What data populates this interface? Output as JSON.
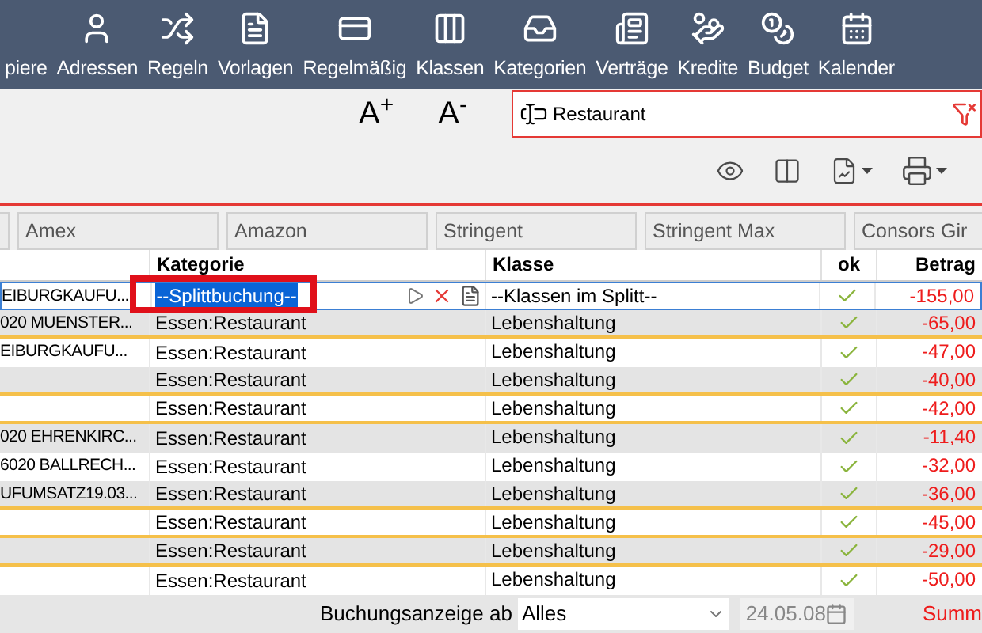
{
  "toolbar": [
    {
      "label": "piere"
    },
    {
      "label": "Adressen"
    },
    {
      "label": "Regeln"
    },
    {
      "label": "Vorlagen"
    },
    {
      "label": "Regelmäßig"
    },
    {
      "label": "Klassen"
    },
    {
      "label": "Kategorien"
    },
    {
      "label": "Verträge"
    },
    {
      "label": "Kredite"
    },
    {
      "label": "Budget"
    },
    {
      "label": "Kalender"
    }
  ],
  "font_buttons": [
    "A$^{+}$",
    "A$^{-}$"
  ],
  "search": {
    "value": "Restaurant"
  },
  "account_tabs": [
    "Amex",
    "Amazon",
    "Stringent",
    "Stringent Max",
    "Consors Gir"
  ],
  "table": {
    "columns": [
      "Kategorie",
      "Klasse",
      "ok",
      "Betrag"
    ],
    "rows": [
      {
        "column_1": "EIBURGKAUFU...",
        "kategorie": "--Splittbuchung--",
        "klasse": "--Klassen im Splitt--",
        "ok": true,
        "betrag": "-155,00",
        "selected": true,
        "separator_below": false
      },
      {
        "column_1": "020 MUENSTER...",
        "kategorie": "Essen:Restaurant",
        "klasse": "Lebenshaltung",
        "ok": true,
        "betrag": "-65,00",
        "selected": false,
        "separator_below": true
      },
      {
        "column_1": "EIBURGKAUFU...",
        "kategorie": "Essen:Restaurant",
        "klasse": "Lebenshaltung",
        "ok": true,
        "betrag": "-47,00",
        "selected": false,
        "separator_below": false
      },
      {
        "kategorie": "Essen:Restaurant",
        "klasse": "Lebenshaltung",
        "ok": true,
        "betrag": "-40,00",
        "selected": false,
        "separator_below": true
      },
      {
        "kategorie": "Essen:Restaurant",
        "klasse": "Lebenshaltung",
        "ok": true,
        "betrag": "-42,00",
        "selected": false,
        "separator_below": true
      },
      {
        "column_1": "020 EHRENKIRC...",
        "kategorie": "Essen:Restaurant",
        "klasse": "Lebenshaltung",
        "ok": true,
        "betrag": "-11,40",
        "selected": false,
        "separator_below": false
      },
      {
        "column_1": "6020 BALLRECH...",
        "kategorie": "Essen:Restaurant",
        "klasse": "Lebenshaltung",
        "ok": true,
        "betrag": "-32,00",
        "selected": false,
        "separator_below": false
      },
      {
        "column_1": "UFUMSATZ19.03...",
        "kategorie": "Essen:Restaurant",
        "klasse": "Lebenshaltung",
        "ok": true,
        "betrag": "-36,00",
        "selected": false,
        "separator_below": true
      },
      {
        "kategorie": "Essen:Restaurant",
        "klasse": "Lebenshaltung",
        "ok": true,
        "betrag": "-45,00",
        "selected": false,
        "separator_below": true
      },
      {
        "kategorie": "Essen:Restaurant",
        "klasse": "Lebenshaltung",
        "ok": true,
        "betrag": "-29,00",
        "selected": false,
        "separator_below": true
      },
      {
        "kategorie": "Essen:Restaurant",
        "klasse": "Lebenshaltung",
        "ok": true,
        "betrag": "-50,00",
        "selected": false,
        "separator_below": false
      }
    ]
  },
  "footer": {
    "label": "Buchungsanzeige ab",
    "period": "Alles",
    "date": "24.05.08",
    "date_disabled": true,
    "sum_label": "Summ"
  }
}
